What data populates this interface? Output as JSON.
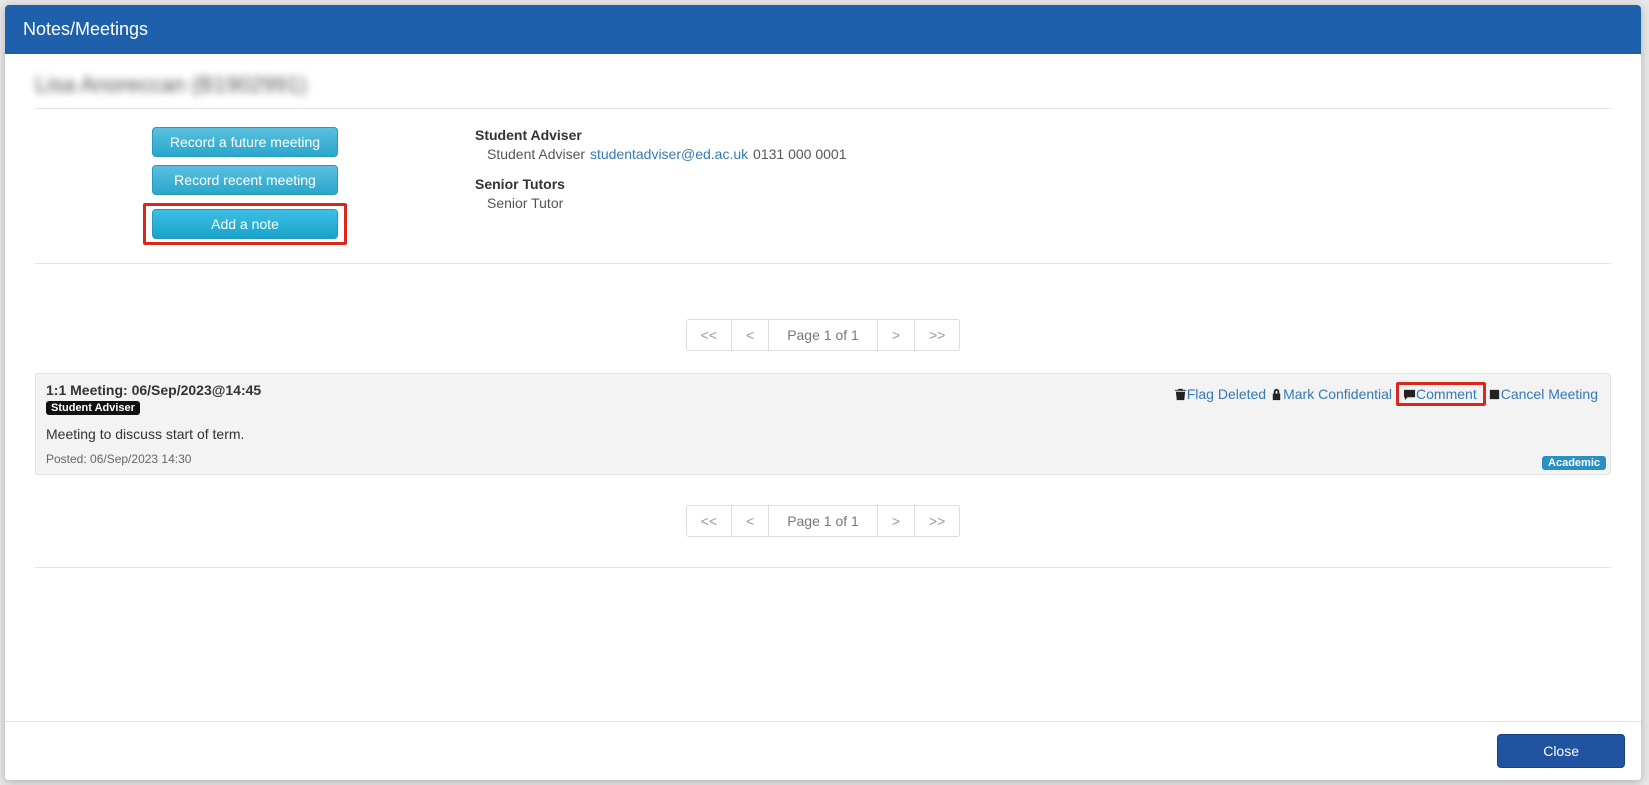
{
  "modal": {
    "title": "Notes/Meetings"
  },
  "student_name": "Lisa Anoreccan (B1902991)",
  "buttons": {
    "record_future": "Record a future meeting",
    "record_recent": "Record recent meeting",
    "add_note": "Add a note"
  },
  "adviser_section": {
    "heading": "Student Adviser",
    "role": "Student Adviser",
    "email": "studentadviser@ed.ac.uk",
    "phone": "0131 000 0001"
  },
  "tutor_section": {
    "heading": "Senior Tutors",
    "role": "Senior Tutor"
  },
  "pagination": {
    "first": "<<",
    "prev": "<",
    "label": "Page 1 of 1",
    "next": ">",
    "last": ">>"
  },
  "note": {
    "title": "1:1 Meeting: 06/Sep/2023@14:45",
    "badge": "Student Adviser",
    "body": "Meeting to discuss start of term.",
    "posted": "Posted: 06/Sep/2023 14:30",
    "category": "Academic",
    "actions": {
      "flag_deleted": "Flag Deleted",
      "mark_confidential": "Mark Confidential",
      "comment": "Comment",
      "cancel_meeting": "Cancel Meeting"
    }
  },
  "footer": {
    "close": "Close"
  }
}
